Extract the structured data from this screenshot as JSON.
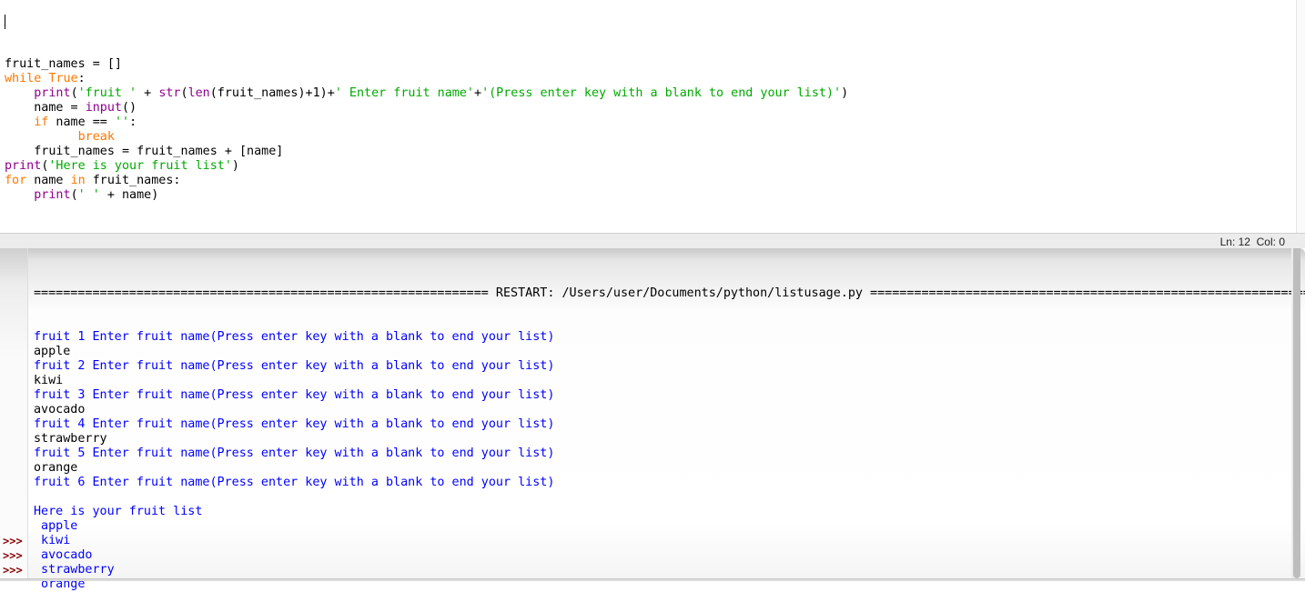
{
  "editor": {
    "code_lines": [
      [
        {
          "t": "fruit_names = []",
          "c": ""
        }
      ],
      [
        {
          "t": "while",
          "c": "kw"
        },
        {
          "t": " ",
          "c": ""
        },
        {
          "t": "True",
          "c": "kw"
        },
        {
          "t": ":",
          "c": ""
        }
      ],
      [
        {
          "t": "    ",
          "c": ""
        },
        {
          "t": "print",
          "c": "bi"
        },
        {
          "t": "(",
          "c": ""
        },
        {
          "t": "'fruit '",
          "c": "str"
        },
        {
          "t": " + ",
          "c": ""
        },
        {
          "t": "str",
          "c": "bi"
        },
        {
          "t": "(",
          "c": ""
        },
        {
          "t": "len",
          "c": "bi"
        },
        {
          "t": "(fruit_names)+1)+",
          "c": ""
        },
        {
          "t": "' Enter fruit name'",
          "c": "str"
        },
        {
          "t": "+",
          "c": ""
        },
        {
          "t": "'(Press enter key with a blank to end your list)'",
          "c": "str"
        },
        {
          "t": ")",
          "c": ""
        }
      ],
      [
        {
          "t": "    name = ",
          "c": ""
        },
        {
          "t": "input",
          "c": "bi"
        },
        {
          "t": "()",
          "c": ""
        }
      ],
      [
        {
          "t": "    ",
          "c": ""
        },
        {
          "t": "if",
          "c": "kw"
        },
        {
          "t": " name == ",
          "c": ""
        },
        {
          "t": "''",
          "c": "str"
        },
        {
          "t": ":",
          "c": ""
        }
      ],
      [
        {
          "t": "          ",
          "c": ""
        },
        {
          "t": "break",
          "c": "kw"
        }
      ],
      [
        {
          "t": "    fruit_names = fruit_names + [name]",
          "c": ""
        }
      ],
      [
        {
          "t": "print",
          "c": "bi"
        },
        {
          "t": "(",
          "c": ""
        },
        {
          "t": "'Here is your fruit list'",
          "c": "str"
        },
        {
          "t": ")",
          "c": ""
        }
      ],
      [
        {
          "t": "for",
          "c": "kw"
        },
        {
          "t": " name ",
          "c": ""
        },
        {
          "t": "in",
          "c": "kw"
        },
        {
          "t": " fruit_names:",
          "c": ""
        }
      ],
      [
        {
          "t": "    ",
          "c": ""
        },
        {
          "t": "print",
          "c": "bi"
        },
        {
          "t": "(",
          "c": ""
        },
        {
          "t": "' '",
          "c": "str"
        },
        {
          "t": " + name)",
          "c": ""
        }
      ]
    ]
  },
  "status_bar": {
    "position": "Ln: 12  Col: 0"
  },
  "shell": {
    "restart_line": "============================================================== RESTART: /Users/user/Documents/python/listusage.py ==============================================================",
    "output_lines": [
      {
        "text": "fruit 1 Enter fruit name(Press enter key with a blank to end your list)",
        "kind": "out"
      },
      {
        "text": "apple",
        "kind": "in"
      },
      {
        "text": "fruit 2 Enter fruit name(Press enter key with a blank to end your list)",
        "kind": "out"
      },
      {
        "text": "kiwi",
        "kind": "in"
      },
      {
        "text": "fruit 3 Enter fruit name(Press enter key with a blank to end your list)",
        "kind": "out"
      },
      {
        "text": "avocado",
        "kind": "in"
      },
      {
        "text": "fruit 4 Enter fruit name(Press enter key with a blank to end your list)",
        "kind": "out"
      },
      {
        "text": "strawberry",
        "kind": "in"
      },
      {
        "text": "fruit 5 Enter fruit name(Press enter key with a blank to end your list)",
        "kind": "out"
      },
      {
        "text": "orange",
        "kind": "in"
      },
      {
        "text": "fruit 6 Enter fruit name(Press enter key with a blank to end your list)",
        "kind": "out"
      },
      {
        "text": "",
        "kind": "in"
      },
      {
        "text": "Here is your fruit list",
        "kind": "out"
      },
      {
        "text": " apple",
        "kind": "out"
      },
      {
        "text": " kiwi",
        "kind": "out"
      },
      {
        "text": " avocado",
        "kind": "out"
      },
      {
        "text": " strawberry",
        "kind": "out"
      },
      {
        "text": " orange",
        "kind": "out"
      }
    ],
    "prompts": [
      ">>>",
      ">>>",
      ">>>"
    ]
  },
  "colors": {
    "keyword": "#ff7700",
    "builtin": "#900090",
    "string": "#00aa00",
    "shell_output": "#0000ff",
    "prompt": "#8b0000"
  }
}
